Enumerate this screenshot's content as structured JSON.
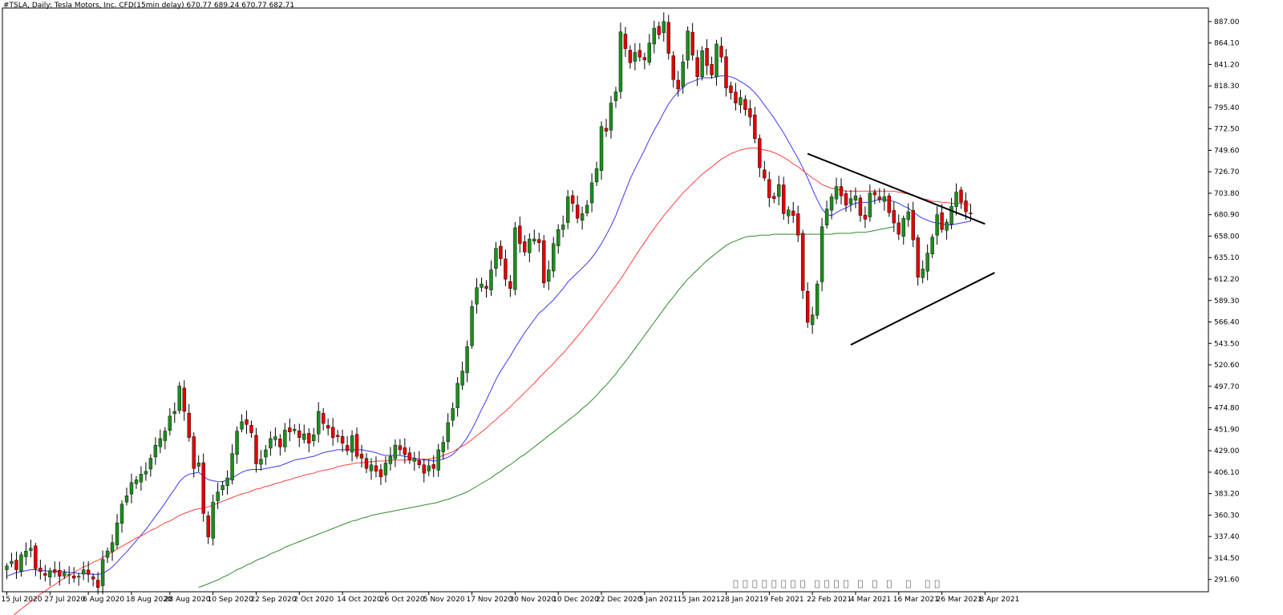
{
  "header": {
    "text": "#TSLA, Daily:  Tesla Motors, Inc.  CFD(15min delay)  670.77 689.24 670.77 682.71"
  },
  "chart_data": {
    "type": "candlestick",
    "symbol": "#TSLA",
    "timeframe": "Daily",
    "ohlc_last": {
      "open": 670.77,
      "high": 689.24,
      "low": 670.77,
      "close": 682.71
    },
    "ylim": [
      278.5,
      898.0
    ],
    "grid": false,
    "y_ticks": [
      "887.00",
      "864.10",
      "841.20",
      "818.30",
      "795.40",
      "772.50",
      "749.60",
      "726.70",
      "703.80",
      "680.90",
      "658.00",
      "635.10",
      "612.20",
      "589.30",
      "566.40",
      "543.50",
      "520.60",
      "497.70",
      "474.80",
      "451.90",
      "429.00",
      "406.10",
      "383.20",
      "360.30",
      "337.40",
      "314.50",
      "291.60"
    ],
    "x_ticks": [
      "15 Jul 2020",
      "27 Jul 2020",
      "6 Aug 2020",
      "18 Aug 2020",
      "28 Aug 2020",
      "10 Sep 2020",
      "22 Sep 2020",
      "2 Oct 2020",
      "14 Oct 2020",
      "26 Oct 2020",
      "5 Nov 2020",
      "17 Nov 2020",
      "30 Nov 2020",
      "10 Dec 2020",
      "22 Dec 2020",
      "5 Jan 2021",
      "15 Jan 2021",
      "28 Jan 2021",
      "9 Feb 2021",
      "22 Feb 2021",
      "4 Mar 2021",
      "16 Mar 2021",
      "26 Mar 2021",
      "8 Apr 2021"
    ],
    "x_tick_index": [
      0,
      9,
      17,
      26,
      34,
      43,
      52,
      61,
      70,
      79,
      88,
      97,
      106,
      115,
      124,
      133,
      141,
      150,
      159,
      168,
      177,
      186,
      195,
      204
    ],
    "candle_spacing_days": 1,
    "colors": {
      "up": "#1e8c1e",
      "down": "#e00000",
      "wick": "#000000"
    },
    "close": [
      306,
      311,
      302,
      318,
      322,
      325,
      303,
      300,
      296,
      301,
      299,
      295,
      299,
      297,
      293,
      295,
      302,
      297,
      292,
      283,
      313,
      322,
      331,
      352,
      372,
      381,
      395,
      398,
      404,
      407,
      421,
      435,
      442,
      450,
      466,
      471,
      498,
      471,
      443,
      410,
      416,
      362,
      337,
      374,
      385,
      392,
      400,
      426,
      450,
      460,
      457,
      448,
      415,
      420,
      430,
      442,
      444,
      433,
      451,
      449,
      452,
      443,
      447,
      437,
      446,
      471,
      458,
      453,
      443,
      444,
      437,
      429,
      445,
      423,
      421,
      410,
      414,
      407,
      401,
      416,
      423,
      435,
      430,
      425,
      419,
      421,
      414,
      405,
      413,
      410,
      430,
      438,
      459,
      474,
      501,
      514,
      540,
      583,
      603,
      607,
      602,
      622,
      645,
      634,
      612,
      602,
      667,
      650,
      641,
      655,
      655,
      651,
      608,
      622,
      650,
      665,
      670,
      700,
      693,
      677,
      682,
      691,
      715,
      730,
      775,
      770,
      800,
      812,
      876,
      858,
      843,
      854,
      849,
      846,
      864,
      880,
      873,
      887,
      853,
      825,
      815,
      844,
      877,
      851,
      828,
      856,
      840,
      830,
      863,
      849,
      816,
      811,
      800,
      806,
      793,
      785,
      762,
      731,
      720,
      699,
      698,
      713,
      682,
      686,
      680,
      659,
      600,
      566,
      574,
      607,
      668,
      687,
      700,
      711,
      701,
      691,
      698,
      701,
      680,
      676,
      704,
      702,
      697,
      700,
      683,
      672,
      660,
      677,
      684,
      654,
      614,
      623,
      640,
      657,
      681,
      665,
      673,
      690,
      705,
      694,
      684,
      682
    ],
    "series": [
      {
        "name": "",
        "color": "#3a3aff",
        "values": [
          295,
          297,
          299,
          300,
          301,
          302,
          302,
          301,
          301,
          300,
          300,
          300,
          300,
          299,
          299,
          298,
          298,
          298,
          297,
          297,
          298,
          301,
          305,
          310,
          316,
          321,
          327,
          333,
          339,
          345,
          352,
          359,
          366,
          373,
          381,
          388,
          396,
          401,
          404,
          405,
          406,
          402,
          398,
          397,
          396,
          396,
          398,
          400,
          403,
          406,
          408,
          409,
          409,
          409,
          410,
          411,
          412,
          413,
          415,
          417,
          419,
          420,
          421,
          422,
          423,
          425,
          427,
          428,
          429,
          430,
          430,
          430,
          430,
          430,
          430,
          429,
          428,
          427,
          425,
          424,
          424,
          424,
          424,
          423,
          422,
          421,
          420,
          419,
          419,
          418,
          419,
          420,
          422,
          425,
          430,
          436,
          443,
          452,
          462,
          473,
          483,
          494,
          505,
          514,
          522,
          530,
          539,
          547,
          555,
          562,
          569,
          576,
          580,
          585,
          590,
          596,
          602,
          609,
          614,
          619,
          624,
          629,
          635,
          642,
          650,
          659,
          669,
          680,
          693,
          706,
          719,
          730,
          740,
          750,
          761,
          771,
          780,
          790,
          799,
          806,
          812,
          817,
          821,
          823,
          825,
          827,
          827,
          827,
          828,
          829,
          829,
          828,
          826,
          823,
          820,
          816,
          811,
          805,
          798,
          791,
          784,
          776,
          768,
          759,
          750,
          741,
          731,
          720,
          708,
          697,
          687,
          681,
          680,
          683,
          686,
          688,
          691,
          693,
          694,
          694,
          694,
          696,
          697,
          697,
          696,
          695,
          693,
          690,
          688,
          684,
          680,
          677,
          675,
          673,
          672,
          671,
          670,
          670,
          671,
          672,
          673,
          674
        ]
      },
      {
        "name": "",
        "color": "#ff4040",
        "values": [
          248,
          252,
          256,
          260,
          264,
          268,
          272,
          276,
          279,
          283,
          286,
          290,
          293,
          296,
          299,
          302,
          305,
          307,
          310,
          312,
          315,
          318,
          321,
          324,
          327,
          330,
          333,
          336,
          338,
          341,
          344,
          346,
          349,
          352,
          354,
          357,
          360,
          362,
          364,
          366,
          367,
          368,
          369,
          371,
          373,
          375,
          377,
          379,
          381,
          383,
          384,
          386,
          388,
          389,
          391,
          392,
          394,
          395,
          397,
          398,
          400,
          401,
          403,
          404,
          405,
          407,
          408,
          409,
          410,
          412,
          413,
          414,
          415,
          416,
          416,
          417,
          417,
          418,
          418,
          418,
          419,
          419,
          419,
          419,
          419,
          419,
          420,
          420,
          420,
          421,
          422,
          424,
          426,
          428,
          431,
          434,
          437,
          441,
          445,
          449,
          453,
          458,
          462,
          467,
          471,
          476,
          481,
          486,
          491,
          496,
          501,
          507,
          512,
          517,
          522,
          528,
          533,
          539,
          545,
          551,
          557,
          564,
          570,
          577,
          584,
          591,
          598,
          605,
          612,
          620,
          628,
          636,
          644,
          651,
          659,
          666,
          673,
          680,
          686,
          692,
          698,
          704,
          709,
          714,
          719,
          724,
          728,
          732,
          736,
          740,
          743,
          746,
          748,
          750,
          751,
          752,
          752,
          751,
          750,
          749,
          747,
          745,
          742,
          739,
          735,
          732,
          728,
          724,
          720,
          717,
          713,
          711,
          709,
          708,
          707,
          706,
          706,
          706,
          706,
          706,
          706,
          706,
          706,
          706,
          706,
          706,
          705,
          704,
          703,
          702,
          700,
          698,
          697,
          695,
          695,
          694,
          694,
          693,
          693,
          693,
          692,
          692
        ]
      },
      {
        "name": "",
        "color": "#2e8b2e",
        "values": [
          null,
          null,
          null,
          null,
          null,
          null,
          null,
          null,
          null,
          null,
          null,
          null,
          null,
          null,
          null,
          null,
          null,
          null,
          null,
          null,
          null,
          null,
          null,
          null,
          null,
          null,
          null,
          null,
          null,
          null,
          null,
          null,
          null,
          null,
          null,
          null,
          null,
          null,
          null,
          null,
          283,
          285,
          287,
          289,
          291,
          294,
          296,
          299,
          302,
          304,
          307,
          309,
          312,
          314,
          316,
          319,
          321,
          323,
          326,
          328,
          330,
          332,
          334,
          336,
          338,
          340,
          342,
          344,
          346,
          348,
          350,
          352,
          354,
          355,
          357,
          358,
          360,
          361,
          362,
          363,
          364,
          365,
          366,
          367,
          368,
          369,
          370,
          371,
          372,
          373,
          374,
          376,
          377,
          379,
          381,
          383,
          385,
          388,
          391,
          394,
          397,
          400,
          404,
          407,
          411,
          414,
          418,
          422,
          425,
          429,
          433,
          437,
          441,
          445,
          449,
          453,
          457,
          461,
          465,
          469,
          474,
          478,
          483,
          488,
          494,
          499,
          505,
          511,
          518,
          524,
          531,
          538,
          545,
          552,
          559,
          566,
          573,
          580,
          587,
          593,
          600,
          606,
          612,
          617,
          622,
          627,
          632,
          636,
          640,
          644,
          648,
          651,
          653,
          655,
          657,
          658,
          658,
          659,
          659,
          659,
          660,
          660,
          660,
          660,
          660,
          660,
          660,
          660,
          660,
          660,
          660,
          660,
          660,
          661,
          661,
          661,
          661,
          662,
          662,
          662,
          663,
          664,
          665,
          666,
          667,
          668
        ]
      }
    ],
    "trendlines": [
      {
        "from": {
          "x_index": 167,
          "y": 746
        },
        "to": {
          "x_index": 204,
          "y": 671
        }
      },
      {
        "from": {
          "x_index": 176,
          "y": 542
        },
        "to": {
          "x_index": 206,
          "y": 619
        }
      }
    ]
  },
  "event_markers": [
    "E",
    "E",
    "E",
    "E",
    "E",
    "E",
    "E",
    "E",
    "E",
    "E",
    "E",
    "E",
    "E",
    "E",
    "E",
    "E",
    "E",
    "E"
  ]
}
